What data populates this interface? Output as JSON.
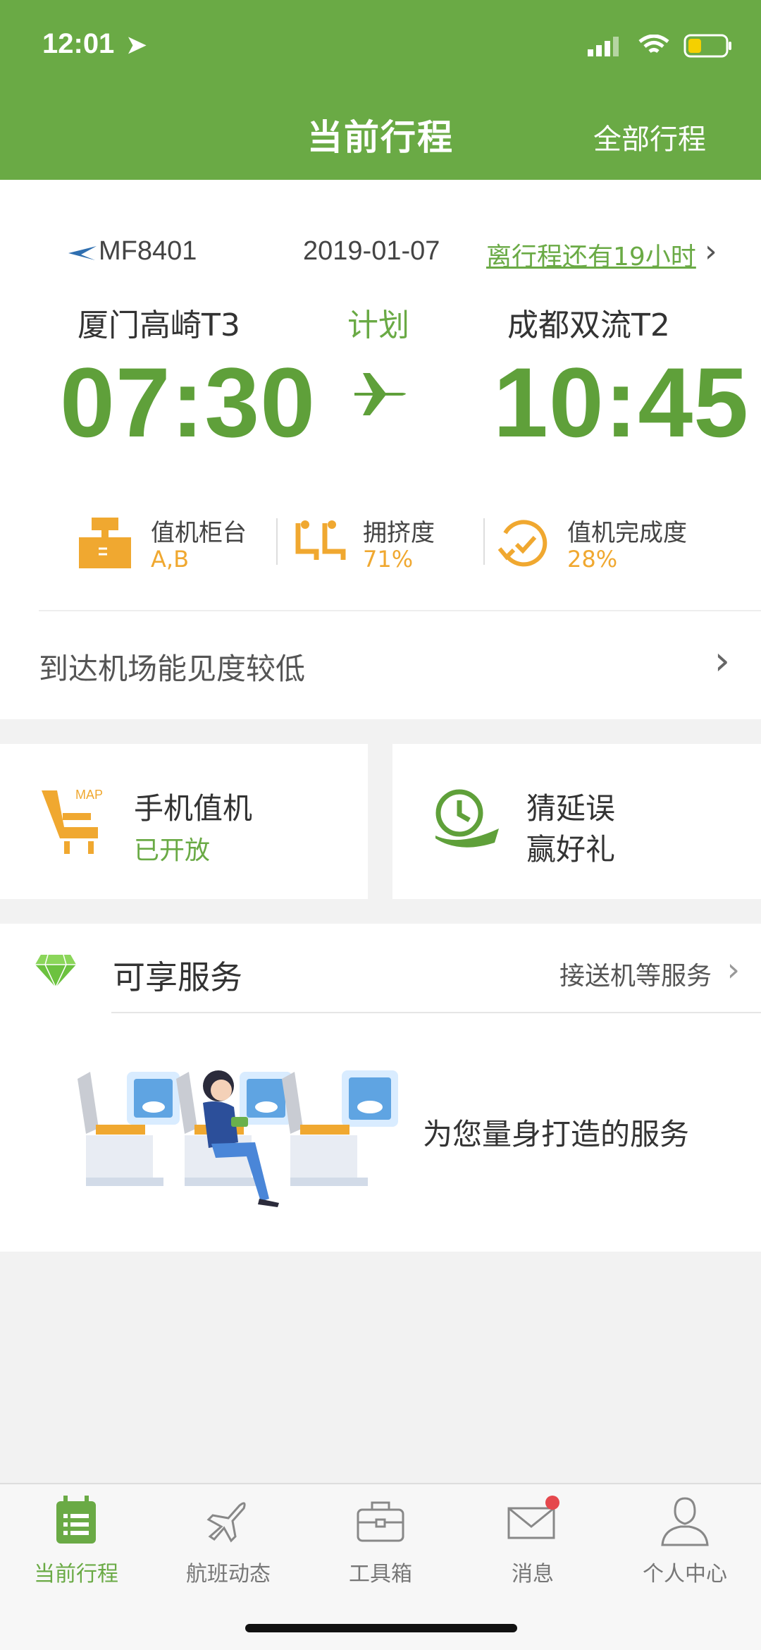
{
  "status_bar": {
    "time": "12:01"
  },
  "header": {
    "title": "当前行程",
    "right_action": "全部行程"
  },
  "trip": {
    "flight_no": "MF8401",
    "date": "2019-01-07",
    "countdown": "离行程还有19小时",
    "status": "计划",
    "departure": {
      "airport": "厦门高崎T3",
      "time": "07:30"
    },
    "arrival": {
      "airport": "成都双流T2",
      "time": "10:45"
    },
    "stats": [
      {
        "label": "值机柜台",
        "value": "A,B",
        "icon": "checkin-counter-icon"
      },
      {
        "label": "拥挤度",
        "value": "71%",
        "icon": "crowd-seats-icon"
      },
      {
        "label": "值机完成度",
        "value": "28%",
        "icon": "clock-check-icon"
      }
    ],
    "notice": "到达机场能见度较低"
  },
  "tiles": {
    "mobile_checkin": {
      "title": "手机值机",
      "sub": "已开放",
      "icon": "seat-map-icon"
    },
    "delay_game": {
      "line1": "猜延误",
      "line2": "赢好礼",
      "icon": "delay-clock-icon"
    }
  },
  "services": {
    "title": "可享服务",
    "more": "接送机等服务",
    "desc": "为您量身打造的服务",
    "badge_icon": "diamond-icon",
    "illustration": "cabin-seats-illustration"
  },
  "tabbar": {
    "items": [
      {
        "label": "当前行程",
        "icon": "calendar-list-icon",
        "active": true
      },
      {
        "label": "航班动态",
        "icon": "plane-icon",
        "active": false
      },
      {
        "label": "工具箱",
        "icon": "toolbox-icon",
        "active": false
      },
      {
        "label": "消息",
        "icon": "mail-icon",
        "active": false
      },
      {
        "label": "个人中心",
        "icon": "user-icon",
        "active": false
      }
    ]
  },
  "colors": {
    "brand_green": "#6aaa45",
    "accent_orange": "#f0a830",
    "badge_red": "#e5484d"
  }
}
